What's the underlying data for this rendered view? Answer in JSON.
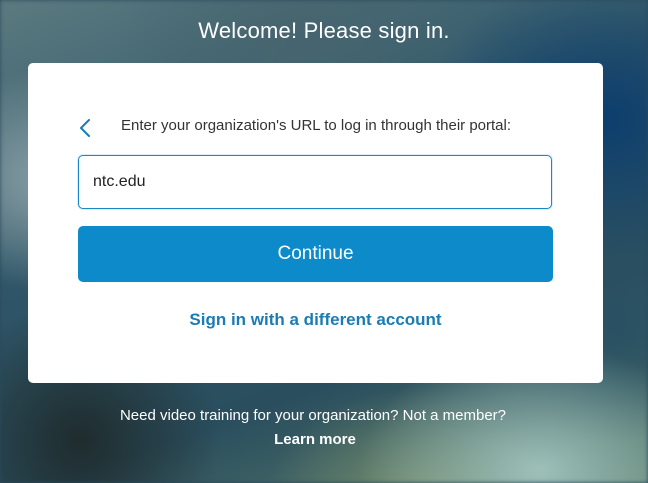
{
  "header": {
    "title": "Welcome! Please sign in."
  },
  "card": {
    "back_icon": "chevron-left-icon",
    "prompt": "Enter your organization's URL to log in through their portal:",
    "url_input": {
      "value": "ntc.edu",
      "placeholder": ""
    },
    "continue_label": "Continue",
    "different_account_label": "Sign in with a different account"
  },
  "footer": {
    "text": "Need video training for your organization? Not a member?",
    "learn_more_label": "Learn more"
  },
  "colors": {
    "accent": "#0d8ac9",
    "link": "#1b7cb5",
    "input_border": "#1a87c6"
  }
}
